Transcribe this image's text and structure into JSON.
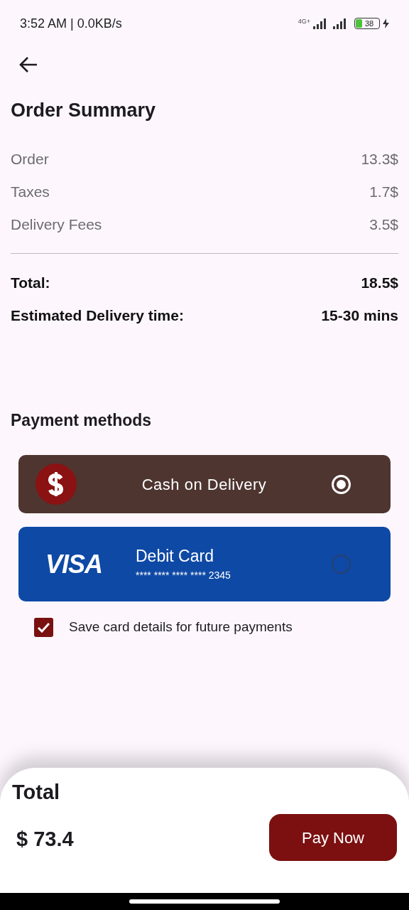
{
  "status_bar": {
    "time": "3:52 AM | 0.0KB/s",
    "network": "4G+",
    "battery": "38",
    "charging": true
  },
  "title": "Order Summary",
  "lines": [
    {
      "label": "Order",
      "value": "13.3$"
    },
    {
      "label": "Taxes",
      "value": "1.7$"
    },
    {
      "label": "Delivery Fees",
      "value": "3.5$"
    }
  ],
  "totals": [
    {
      "label": "Total:",
      "value": "18.5$"
    },
    {
      "label": "Estimated Delivery time:",
      "value": "15-30 mins"
    }
  ],
  "payment_title": "Payment methods",
  "payment_methods": [
    {
      "kind": "cash",
      "label": "Cash on Delivery",
      "selected": true
    },
    {
      "kind": "card",
      "label": "Debit Card",
      "number": "**** **** **** **** 2345",
      "logo": "VISA",
      "selected": false
    }
  ],
  "save_card": {
    "label": "Save card details for future payments",
    "checked": true
  },
  "footer": {
    "label": "Total",
    "amount": "$ 73.4",
    "button": "Pay Now"
  }
}
